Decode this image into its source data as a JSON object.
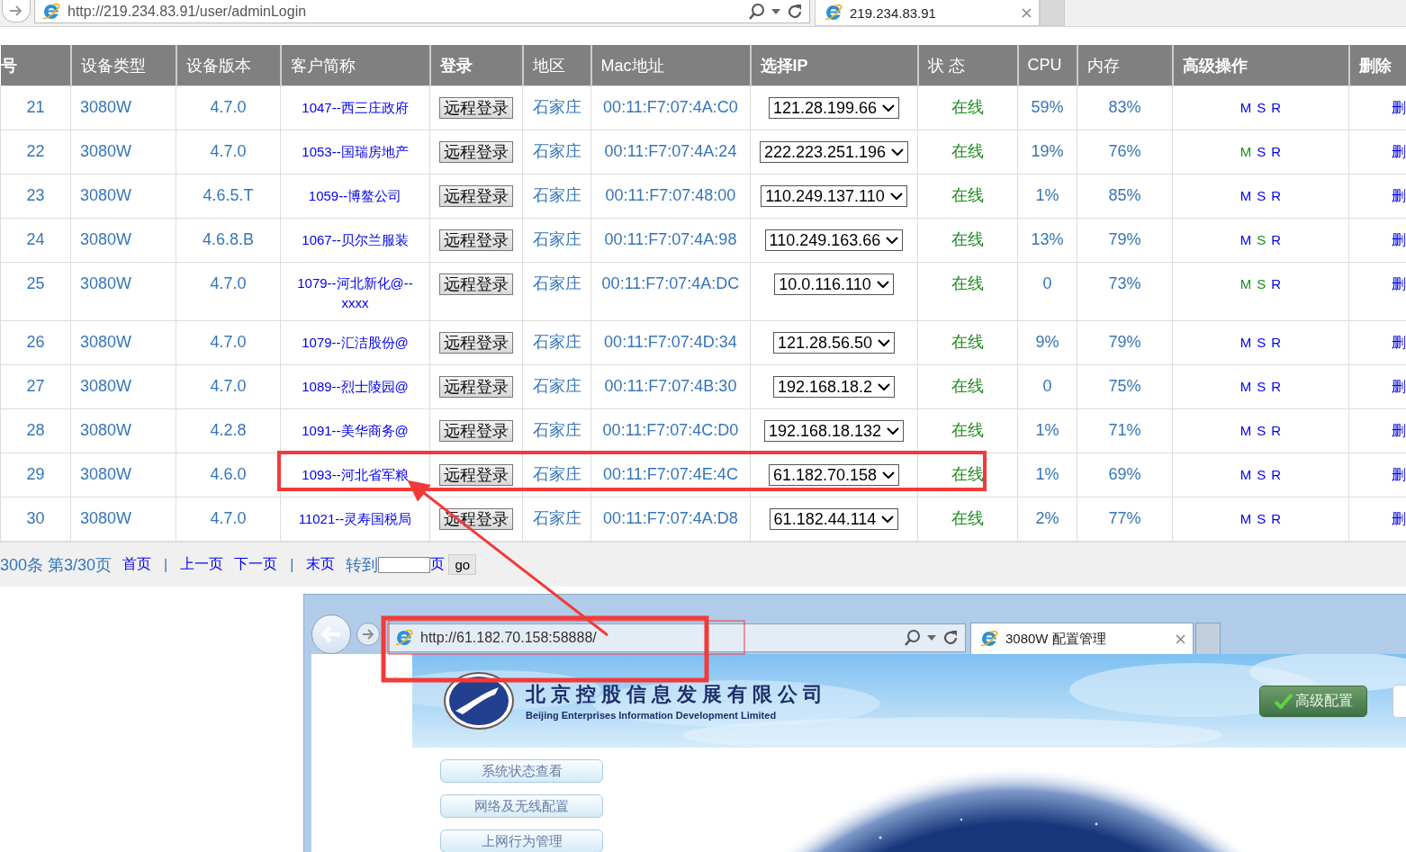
{
  "browser": {
    "url": "http://219.234.83.91/user/adminLogin",
    "tab_title": "219.234.83.91"
  },
  "table": {
    "columns": [
      {
        "label": "号",
        "bold": true
      },
      {
        "label": "设备类型",
        "bold": false
      },
      {
        "label": "设备版本",
        "bold": false
      },
      {
        "label": "客户简称",
        "bold": false
      },
      {
        "label": "登录",
        "bold": true
      },
      {
        "label": "地区",
        "bold": false
      },
      {
        "label": "Mac地址",
        "bold": false
      },
      {
        "label": "选择IP",
        "bold": true
      },
      {
        "label": "状 态",
        "bold": false
      },
      {
        "label": "CPU",
        "bold": false
      },
      {
        "label": "内存",
        "bold": false
      },
      {
        "label": "高级操作",
        "bold": true
      },
      {
        "label": "删除",
        "bold": true
      }
    ],
    "rows": [
      {
        "no": "21",
        "device_type": "3080W",
        "version": "4.7.0",
        "customer": "1047--西三庄政府",
        "login": "远程登录",
        "region": "石家庄",
        "mac": "00:11:F7:07:4A:C0",
        "ip": "121.28.199.66",
        "status": "在线",
        "cpu": "59%",
        "memory": "83%",
        "actions": [
          {
            "label": "M",
            "visited": false
          },
          {
            "label": "S",
            "visited": false
          },
          {
            "label": "R",
            "visited": false
          }
        ],
        "delete": "删"
      },
      {
        "no": "22",
        "device_type": "3080W",
        "version": "4.7.0",
        "customer": "1053--国瑞房地产",
        "login": "远程登录",
        "region": "石家庄",
        "mac": "00:11:F7:07:4A:24",
        "ip": "222.223.251.196",
        "status": "在线",
        "cpu": "19%",
        "memory": "76%",
        "actions": [
          {
            "label": "M",
            "visited": true
          },
          {
            "label": "S",
            "visited": false
          },
          {
            "label": "R",
            "visited": false
          }
        ],
        "delete": "删"
      },
      {
        "no": "23",
        "device_type": "3080W",
        "version": "4.6.5.T",
        "customer": "1059--博鳌公司",
        "login": "远程登录",
        "region": "石家庄",
        "mac": "00:11:F7:07:48:00",
        "ip": "110.249.137.110",
        "status": "在线",
        "cpu": "1%",
        "memory": "85%",
        "actions": [
          {
            "label": "M",
            "visited": false
          },
          {
            "label": "S",
            "visited": false
          },
          {
            "label": "R",
            "visited": false
          }
        ],
        "delete": "删"
      },
      {
        "no": "24",
        "device_type": "3080W",
        "version": "4.6.8.B",
        "customer": "1067--贝尔兰服装",
        "login": "远程登录",
        "region": "石家庄",
        "mac": "00:11:F7:07:4A:98",
        "ip": "110.249.163.66",
        "status": "在线",
        "cpu": "13%",
        "memory": "79%",
        "actions": [
          {
            "label": "M",
            "visited": false
          },
          {
            "label": "S",
            "visited": true
          },
          {
            "label": "R",
            "visited": false
          }
        ],
        "delete": "删"
      },
      {
        "no": "25",
        "device_type": "3080W",
        "version": "4.7.0",
        "customer": "1079--河北新化@--xxxx",
        "login": "远程登录",
        "region": "石家庄",
        "mac": "00:11:F7:07:4A:DC",
        "ip": "10.0.116.110",
        "status": "在线",
        "cpu": "0",
        "memory": "73%",
        "actions": [
          {
            "label": "M",
            "visited": true
          },
          {
            "label": "S",
            "visited": true
          },
          {
            "label": "R",
            "visited": false
          }
        ],
        "delete": "删"
      },
      {
        "no": "26",
        "device_type": "3080W",
        "version": "4.7.0",
        "customer": "1079--汇洁股份@",
        "login": "远程登录",
        "region": "石家庄",
        "mac": "00:11:F7:07:4D:34",
        "ip": "121.28.56.50",
        "status": "在线",
        "cpu": "9%",
        "memory": "79%",
        "actions": [
          {
            "label": "M",
            "visited": false
          },
          {
            "label": "S",
            "visited": false
          },
          {
            "label": "R",
            "visited": false
          }
        ],
        "delete": "删"
      },
      {
        "no": "27",
        "device_type": "3080W",
        "version": "4.7.0",
        "customer": "1089--烈士陵园@",
        "login": "远程登录",
        "region": "石家庄",
        "mac": "00:11:F7:07:4B:30",
        "ip": "192.168.18.2",
        "status": "在线",
        "cpu": "0",
        "memory": "75%",
        "actions": [
          {
            "label": "M",
            "visited": false
          },
          {
            "label": "S",
            "visited": false
          },
          {
            "label": "R",
            "visited": false
          }
        ],
        "delete": "删"
      },
      {
        "no": "28",
        "device_type": "3080W",
        "version": "4.2.8",
        "customer": "1091--美华商务@",
        "login": "远程登录",
        "region": "石家庄",
        "mac": "00:11:F7:07:4C:D0",
        "ip": "192.168.18.132",
        "status": "在线",
        "cpu": "1%",
        "memory": "71%",
        "actions": [
          {
            "label": "M",
            "visited": false
          },
          {
            "label": "S",
            "visited": false
          },
          {
            "label": "R",
            "visited": false
          }
        ],
        "delete": "删"
      },
      {
        "no": "29",
        "device_type": "3080W",
        "version": "4.6.0",
        "customer": "1093--河北省军粮",
        "login": "远程登录",
        "region": "石家庄",
        "mac": "00:11:F7:07:4E:4C",
        "ip": "61.182.70.158",
        "status": "在线",
        "cpu": "1%",
        "memory": "69%",
        "actions": [
          {
            "label": "M",
            "visited": false
          },
          {
            "label": "S",
            "visited": false
          },
          {
            "label": "R",
            "visited": false
          }
        ],
        "delete": "删"
      },
      {
        "no": "30",
        "device_type": "3080W",
        "version": "4.7.0",
        "customer": "11021--灵寿国税局",
        "login": "远程登录",
        "region": "石家庄",
        "mac": "00:11:F7:07:4A:D8",
        "ip": "61.182.44.114",
        "status": "在线",
        "cpu": "2%",
        "memory": "77%",
        "actions": [
          {
            "label": "M",
            "visited": false
          },
          {
            "label": "S",
            "visited": false
          },
          {
            "label": "R",
            "visited": false
          }
        ],
        "delete": "删"
      }
    ]
  },
  "pagination": {
    "summary": "300条 第3/30页",
    "items": [
      {
        "kind": "link",
        "text": "首页"
      },
      {
        "kind": "separator",
        "text": "|"
      },
      {
        "kind": "link",
        "text": "上一页"
      },
      {
        "kind": "link",
        "text": "下一页"
      },
      {
        "kind": "separator",
        "text": "|"
      },
      {
        "kind": "link",
        "text": "末页"
      }
    ],
    "goto_label": "转到",
    "page_unit": "页",
    "go_button": "go"
  },
  "inner_browser": {
    "url": "http://61.182.70.158:58888/",
    "tab_title": "3080W 配置管理",
    "company_name_cn": "北京控股信息发展有限公司",
    "company_name_en": "Beijing Enterprises Information Development Limited",
    "advanced_button": "高级配置",
    "menu": [
      "系统状态查看",
      "网络及无线配置",
      "上网行为管理"
    ]
  }
}
